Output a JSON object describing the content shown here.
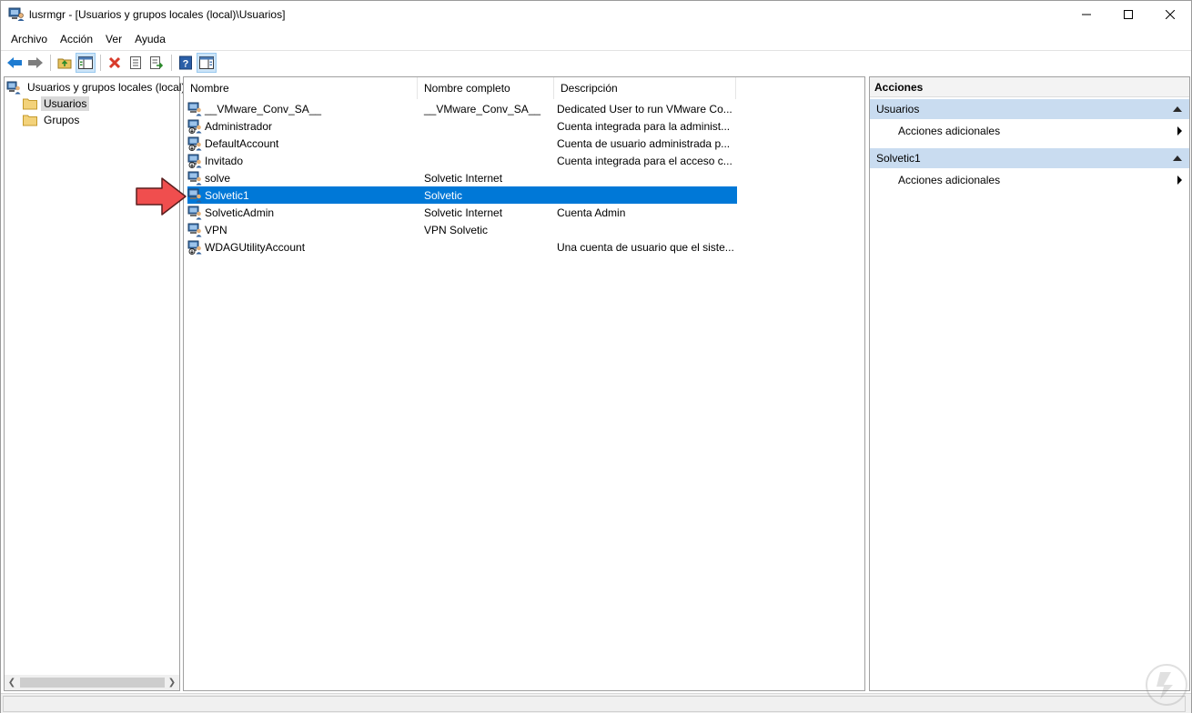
{
  "window": {
    "title": "lusrmgr - [Usuarios y grupos locales (local)\\Usuarios]"
  },
  "menu": [
    "Archivo",
    "Acción",
    "Ver",
    "Ayuda"
  ],
  "toolbar": {
    "buttons": [
      "back-icon",
      "forward-icon",
      "up-folder-icon",
      "show-hide-tree-icon",
      "delete-icon",
      "properties-icon",
      "export-list-icon",
      "help-icon",
      "show-hide-action-pane-icon"
    ]
  },
  "tree": {
    "root": "Usuarios y grupos locales (local)",
    "items": [
      "Usuarios",
      "Grupos"
    ],
    "selected": "Usuarios"
  },
  "list": {
    "columns": [
      "Nombre",
      "Nombre completo",
      "Descripción"
    ],
    "rows": [
      {
        "name": "__VMware_Conv_SA__",
        "full": "__VMware_Conv_SA__",
        "desc": "Dedicated User to run VMware Co...",
        "disabled": false
      },
      {
        "name": "Administrador",
        "full": "",
        "desc": "Cuenta integrada para la administ...",
        "disabled": true
      },
      {
        "name": "DefaultAccount",
        "full": "",
        "desc": "Cuenta de usuario administrada p...",
        "disabled": true
      },
      {
        "name": "Invitado",
        "full": "",
        "desc": "Cuenta integrada para el acceso c...",
        "disabled": true
      },
      {
        "name": "solve",
        "full": "Solvetic Internet",
        "desc": "",
        "disabled": false
      },
      {
        "name": "Solvetic1",
        "full": "Solvetic",
        "desc": "",
        "disabled": false
      },
      {
        "name": "SolveticAdmin",
        "full": "Solvetic Internet",
        "desc": "Cuenta Admin",
        "disabled": false
      },
      {
        "name": "VPN",
        "full": "VPN Solvetic",
        "desc": "",
        "disabled": false
      },
      {
        "name": "WDAGUtilityAccount",
        "full": "",
        "desc": "Una cuenta de usuario que el siste...",
        "disabled": true
      }
    ],
    "selected_row": "Solvetic1"
  },
  "actions": {
    "title": "Acciones",
    "sections": [
      {
        "label": "Usuarios",
        "item": "Acciones adicionales"
      },
      {
        "label": "Solvetic1",
        "item": "Acciones adicionales"
      }
    ]
  },
  "colors": {
    "selection": "#0078d7",
    "section_header": "#c9dcf0",
    "annotation_arrow": "#f04e4e"
  }
}
